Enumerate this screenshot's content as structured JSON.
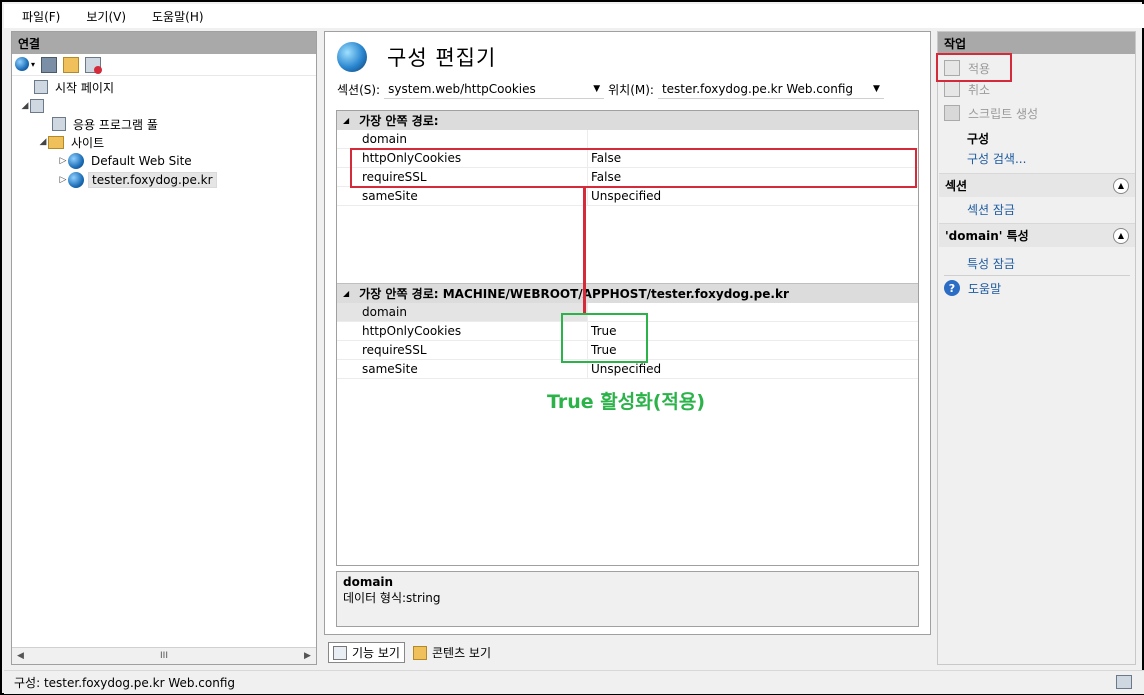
{
  "menu": [
    "파일(F)",
    "보기(V)",
    "도움말(H)"
  ],
  "left": {
    "header": "연결",
    "tree": [
      {
        "label": "시작 페이지",
        "icon": "start-page-icon"
      },
      {
        "label": "",
        "icon": "server-icon"
      },
      {
        "label": "응용 프로그램 풀",
        "icon": "app-pool-icon"
      },
      {
        "label": "사이트",
        "icon": "sites-folder-icon"
      },
      {
        "label": "Default Web Site",
        "icon": "globe-icon"
      },
      {
        "label": "tester.foxydog.pe.kr",
        "icon": "globe-icon"
      }
    ],
    "scroll_thumb": "III"
  },
  "center": {
    "title": "구성 편집기",
    "section_label": "섹션(S):",
    "section_value": "system.web/httpCookies",
    "location_label": "위치(M):",
    "location_value": "tester.foxydog.pe.kr Web.config",
    "group1": {
      "header": "가장 안쪽 경로:",
      "rows": [
        {
          "key": "domain",
          "value": ""
        },
        {
          "key": "httpOnlyCookies",
          "value": "False"
        },
        {
          "key": "requireSSL",
          "value": "False"
        },
        {
          "key": "sameSite",
          "value": "Unspecified"
        }
      ]
    },
    "group2": {
      "header": "가장 안쪽 경로: MACHINE/WEBROOT/APPHOST/tester.foxydog.pe.kr",
      "rows": [
        {
          "key": "domain",
          "value": ""
        },
        {
          "key": "httpOnlyCookies",
          "value": "True"
        },
        {
          "key": "requireSSL",
          "value": "True"
        },
        {
          "key": "sameSite",
          "value": "Unspecified"
        }
      ]
    },
    "desc_title": "domain",
    "desc_text": "데이터 형식:string",
    "annotation": "True 활성화(적용)"
  },
  "bottom_tabs": {
    "features": "기능 보기",
    "content": "콘텐츠 보기"
  },
  "right": {
    "header": "작업",
    "apply": "적용",
    "cancel": "취소",
    "generate_script": "스크립트 생성",
    "config_title": "구성",
    "config_search": "구성 검색...",
    "section_header": "섹션",
    "lock_section": "섹션 잠금",
    "attr_header": "'domain' 특성",
    "lock_attr": "특성 잠금",
    "help": "도움말"
  },
  "status": {
    "text": "구성: tester.foxydog.pe.kr Web.config"
  },
  "colors": {
    "annotation_red": "#d42a3a",
    "annotation_green": "#2bb34a",
    "link_blue": "#1c5aa0",
    "header_gray": "#a9a9a9"
  }
}
